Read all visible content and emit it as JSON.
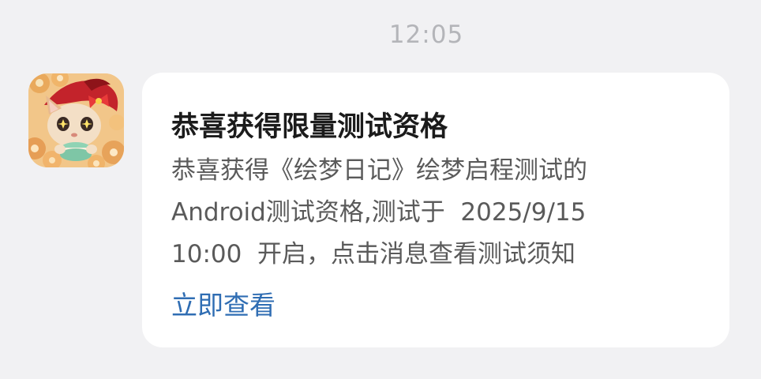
{
  "message": {
    "time": "12:05",
    "app_icon": "game-app-icon",
    "title": "恭喜获得限量测试资格",
    "body_lines": [
      "恭喜获得《绘梦日记》绘梦启程测试的",
      "Android测试资格,测试于  2025/9/15",
      "10:00  开启，点击消息查看测试须知"
    ],
    "action_label": "立即查看"
  },
  "colors": {
    "background": "#f1f1f3",
    "card": "#ffffff",
    "title": "#1b1b1b",
    "body": "#5a5a5a",
    "link": "#2f6db3",
    "time": "#b4b5b9"
  }
}
